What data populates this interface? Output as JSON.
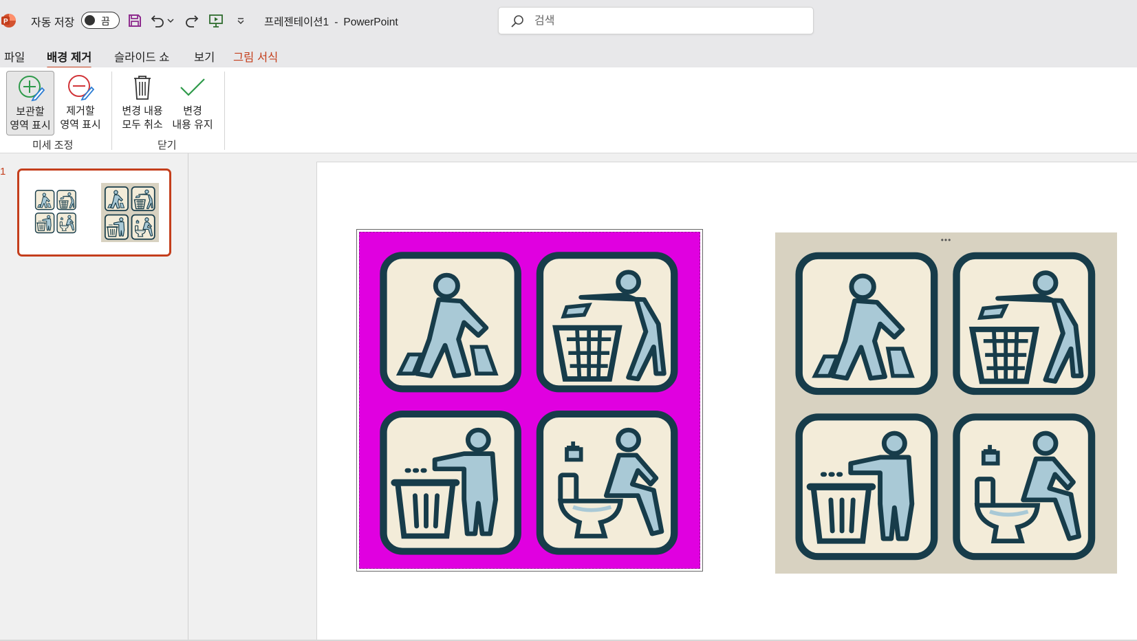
{
  "titlebar": {
    "autosave_label": "자동 저장",
    "autosave_state": "끔",
    "doc_name": "프레젠테이션1",
    "separator": "-",
    "app_name": "PowerPoint",
    "search_placeholder": "검색"
  },
  "tabs": [
    {
      "label": "파일"
    },
    {
      "label": "배경 제거"
    },
    {
      "label": "슬라이드 쇼"
    },
    {
      "label": "보기"
    },
    {
      "label": "그림 서식"
    }
  ],
  "ribbon": {
    "mark_keep": {
      "line1": "보관할",
      "line2": "영역 표시"
    },
    "mark_remove": {
      "line1": "제거할",
      "line2": "영역 표시"
    },
    "discard_all": {
      "line1": "변경 내용",
      "line2": "모두 취소"
    },
    "keep_changes": {
      "line1": "변경",
      "line2": "내용 유지"
    },
    "group_refine": "미세 조정",
    "group_close": "닫기"
  },
  "thumbnails": {
    "slide_number": "1"
  },
  "slide": {
    "handle_dots": "•••"
  },
  "colors": {
    "accent": "#c43e1c",
    "removal_overlay": "#e000e0",
    "icon_stroke": "#173c4a",
    "icon_fill": "#a9c9d6",
    "tile_bg": "#f3ecd9",
    "image_bg": "#d8d2c1"
  }
}
